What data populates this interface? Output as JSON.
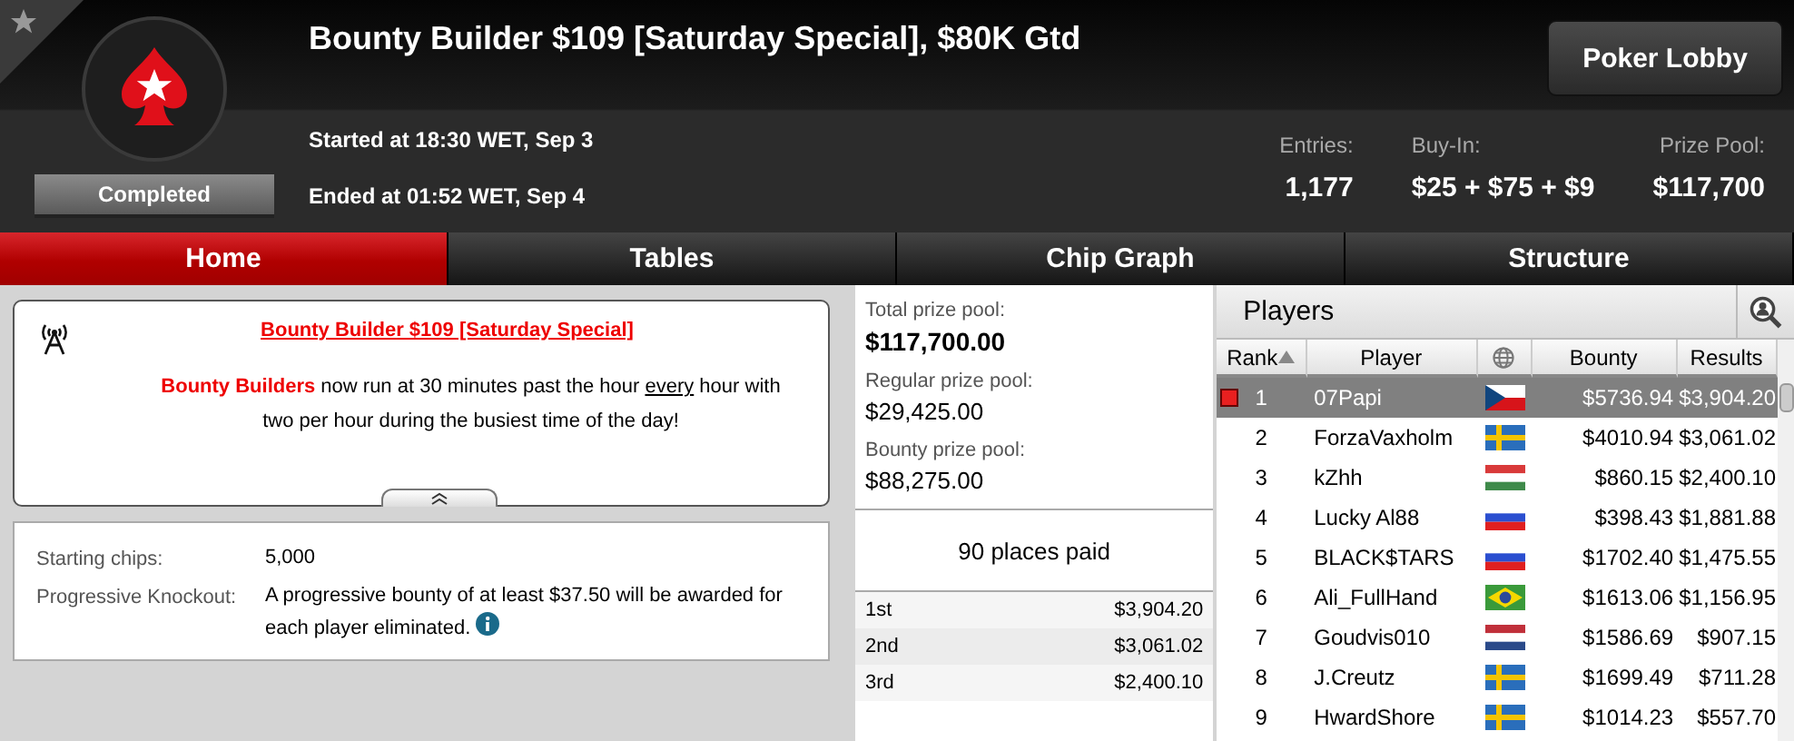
{
  "header": {
    "title": "Bounty Builder $109 [Saturday Special], $80K Gtd",
    "status": "Completed",
    "started": "Started at 18:30 WET, Sep 3",
    "ended": "Ended at 01:52 WET, Sep 4",
    "lobby_button": "Poker Lobby",
    "stats": [
      {
        "label": "Entries:",
        "value": "1,177"
      },
      {
        "label": "Buy-In:",
        "value": "$25 + $75 + $9"
      },
      {
        "label": "Prize Pool:",
        "value": "$117,700"
      }
    ]
  },
  "tabs": [
    {
      "label": "Home",
      "selected": true
    },
    {
      "label": "Tables",
      "selected": false
    },
    {
      "label": "Chip Graph",
      "selected": false
    },
    {
      "label": "Structure",
      "selected": false
    }
  ],
  "announcement": {
    "title": "Bounty Builder $109 [Saturday Special]",
    "body": [
      {
        "kind": "highlight",
        "text": "Bounty Builders"
      },
      {
        "kind": "plain",
        "text": " now run at 30 minutes past the hour "
      },
      {
        "kind": "underline",
        "text": "every"
      },
      {
        "kind": "plain",
        "text": " hour with two per hour during the busiest time of the day!"
      }
    ],
    "expanded": true
  },
  "details": [
    {
      "label": "Starting chips:",
      "value": "5,000",
      "info": false
    },
    {
      "label": "Progressive Knockout:",
      "value": "A progressive bounty of at least $37.50 will be awarded for each player eliminated.",
      "info": true
    }
  ],
  "prize_pools": [
    {
      "label": "Total prize pool:",
      "value": "$117,700.00"
    },
    {
      "label": "Regular prize pool:",
      "value": "$29,425.00"
    },
    {
      "label": "Bounty prize pool:",
      "value": "$88,275.00"
    }
  ],
  "places_paid": "90 places paid",
  "payouts": [
    {
      "place": "1st",
      "amount": "$3,904.20"
    },
    {
      "place": "2nd",
      "amount": "$3,061.02"
    },
    {
      "place": "3rd",
      "amount": "$2,400.10"
    }
  ],
  "players": {
    "title": "Players",
    "columns": [
      "Rank",
      "Player",
      "Bounty",
      "Results"
    ],
    "rows": [
      {
        "rank": "1",
        "name": "07Papi",
        "bounty": "$5736.94",
        "result": "$3,904.20",
        "selected": true,
        "marked": true
      },
      {
        "rank": "2",
        "name": "ForzaVaxholm",
        "bounty": "$4010.94",
        "result": "$3,061.02",
        "selected": false,
        "marked": false
      },
      {
        "rank": "3",
        "name": "kZhh",
        "bounty": "$860.15",
        "result": "$2,400.10",
        "selected": false,
        "marked": false
      },
      {
        "rank": "4",
        "name": "Lucky Al88",
        "bounty": "$398.43",
        "result": "$1,881.88",
        "selected": false,
        "marked": false
      },
      {
        "rank": "5",
        "name": "BLACK$TARS",
        "bounty": "$1702.40",
        "result": "$1,475.55",
        "selected": false,
        "marked": false
      },
      {
        "rank": "6",
        "name": "Ali_FullHand",
        "bounty": "$1613.06",
        "result": "$1,156.95",
        "selected": false,
        "marked": false
      },
      {
        "rank": "7",
        "name": "Goudvis010",
        "bounty": "$1586.69",
        "result": "$907.15",
        "selected": false,
        "marked": false
      },
      {
        "rank": "8",
        "name": "J.Creutz",
        "bounty": "$1699.49",
        "result": "$711.28",
        "selected": false,
        "marked": false
      },
      {
        "rank": "9",
        "name": "HwardShore",
        "bounty": "$1014.23",
        "result": "$557.70",
        "selected": false,
        "marked": false
      }
    ]
  }
}
